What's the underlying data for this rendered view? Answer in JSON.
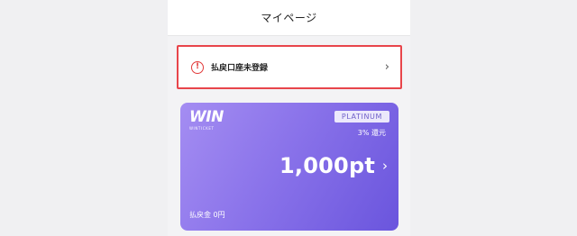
{
  "header": {
    "title": "マイページ"
  },
  "alert": {
    "icon": "exclamation-circle-icon",
    "label": "払戻口座未登録",
    "chevron": "›",
    "border_color": "#e8454b"
  },
  "card": {
    "logo_main": "WIN",
    "logo_sub": "WINTICKET",
    "tier": "PLATINUM",
    "return_rate": "3% 還元",
    "points": "1,000pt",
    "points_chevron": "›",
    "refund_label": "払戻金 0円",
    "gradient_start": "#a48df2",
    "gradient_end": "#6a55dd"
  }
}
